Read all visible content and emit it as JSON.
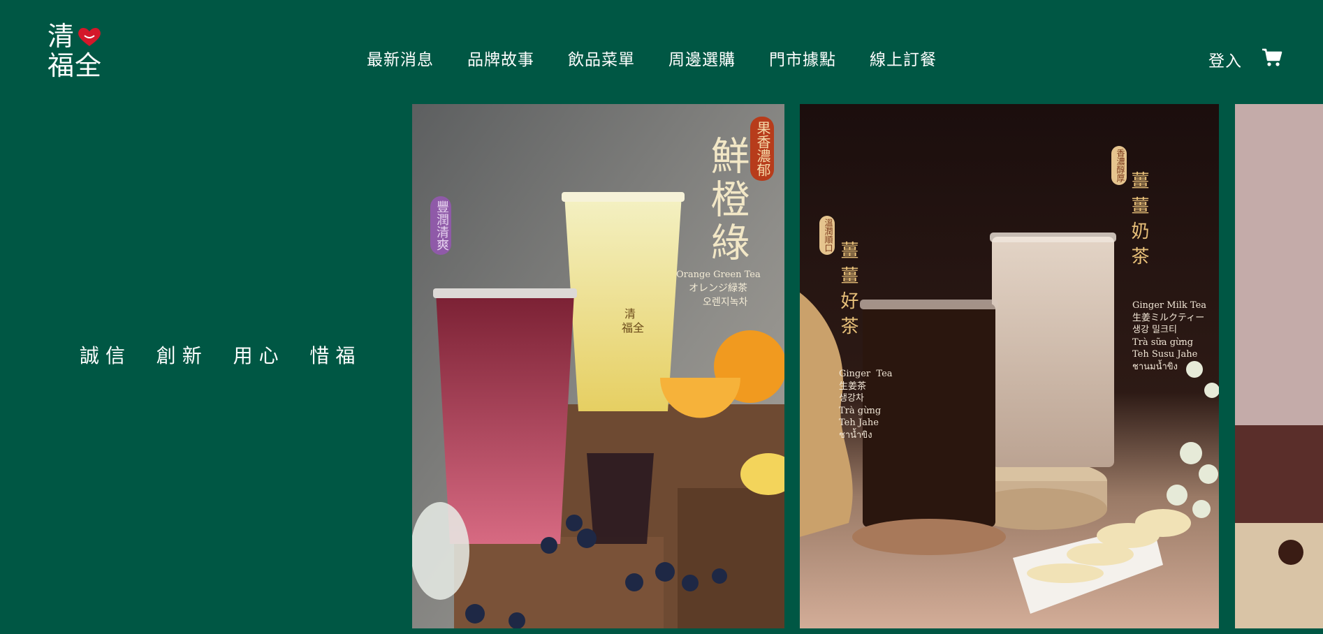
{
  "brand": {
    "logo_line1": "清",
    "logo_line2": "福全"
  },
  "nav": {
    "items": [
      "最新消息",
      "品牌故事",
      "飲品菜單",
      "周邊選購",
      "門市據點",
      "線上訂餐"
    ],
    "login": "登入",
    "cart_icon": "cart-icon"
  },
  "slogan": "誠信  創新  用心  惜福",
  "slides": [
    {
      "badge_top": "果香濃郁",
      "badge_side": "豐潤清爽",
      "title": "鮮橙綠",
      "subtitle_en": "Orange Green Tea",
      "subtitle_jp": "オレンジ緑茶",
      "subtitle_kr": "오렌지녹차",
      "cup_logo_1": "清",
      "cup_logo_2": "福全"
    },
    {
      "badge_left": "溫潤順口",
      "badge_right": "香濃醇厚",
      "title_left": "薑薑好茶",
      "title_right": "薑薑奶茶",
      "left_lines": "Ginger  Tea\n生姜茶\n생강차\nTrà gừng\nTeh Jahe\nชาน้ำขิง",
      "right_lines": "Ginger Milk Tea\n生姜ミルクティー\n생강 밀크티\nTrà sữa gừng\nTeh Susu Jahe\nชานมน้ำขิง"
    }
  ],
  "colors": {
    "background": "#005744",
    "accent_red": "#d4182a",
    "text": "#ffffff"
  }
}
